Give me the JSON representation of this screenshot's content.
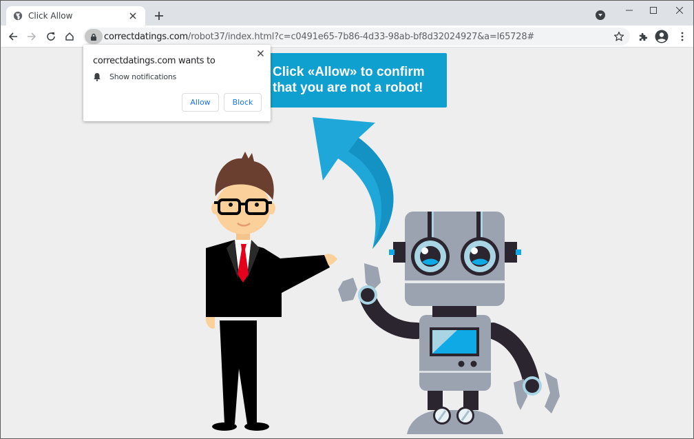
{
  "browser": {
    "tab": {
      "title": "Click Allow",
      "favicon": "globe-icon",
      "close_icon": "close-icon"
    },
    "new_tab_icon": "plus-icon",
    "tab_search_icon": "tab-search-icon",
    "window_controls": {
      "minimize": "minimize-icon",
      "maximize": "maximize-icon",
      "close": "close-icon"
    },
    "nav": {
      "back": "back-arrow-icon",
      "forward": "forward-arrow-icon",
      "reload": "reload-icon",
      "home": "home-icon"
    },
    "address_bar": {
      "lock_icon": "lock-icon",
      "host": "correctdatings.com",
      "path": "/robot37/index.html?c=c0491e65-7b86-4d33-98ab-bf8d32024927&a=l65728#",
      "bookmark_icon": "star-icon"
    },
    "toolbar_icons": {
      "extensions": "puzzle-icon",
      "profile": "profile-icon",
      "menu": "kebab-menu-icon"
    }
  },
  "permission_popup": {
    "title": "correctdatings.com wants to",
    "permission_icon": "bell-icon",
    "permission_label": "Show notifications",
    "allow_label": "Allow",
    "block_label": "Block",
    "close_icon": "close-icon"
  },
  "page": {
    "banner": {
      "line1": "Click «Allow» to confirm",
      "line2": "that you are not a robot!"
    },
    "colors": {
      "background": "#eeeeee",
      "banner": "#0fa0cf",
      "arrow_light": "#1ea7d8",
      "arrow_dark": "#1592c4",
      "robot_gray": "#9aa3af",
      "robot_dark": "#2b2530",
      "robot_blue": "#0fa9e6",
      "suit": "#000000",
      "tie": "#e4001b",
      "hair": "#6b3f30",
      "skin": "#fbd09a"
    }
  }
}
